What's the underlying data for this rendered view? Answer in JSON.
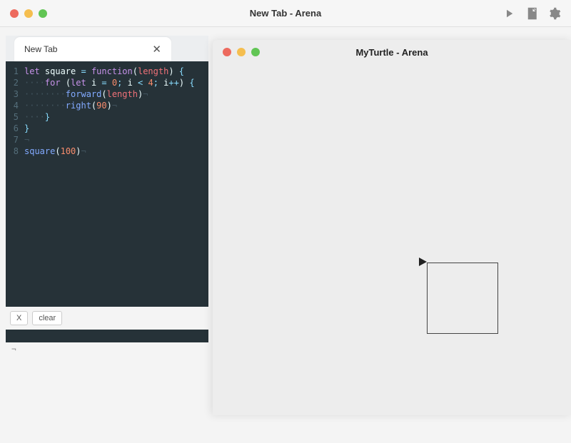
{
  "main_window": {
    "title": "New Tab - Arena",
    "toolbar": {
      "run_icon": "play-icon",
      "doc_icon": "document-icon",
      "settings_icon": "gear-icon"
    }
  },
  "editor": {
    "tab": {
      "label": "New Tab",
      "close_glyph": "✕"
    },
    "lines": [
      {
        "n": "1",
        "tokens": [
          {
            "t": "let ",
            "c": "tok-kw"
          },
          {
            "t": "square",
            "c": "tok-ident"
          },
          {
            "t": " = ",
            "c": "tok-op"
          },
          {
            "t": "function",
            "c": "tok-kw"
          },
          {
            "t": "(",
            "c": "tok-paren"
          },
          {
            "t": "length",
            "c": "tok-special"
          },
          {
            "t": ")",
            "c": "tok-paren"
          },
          {
            "t": " {",
            "c": "tok-brace"
          }
        ]
      },
      {
        "n": "2",
        "tokens": [
          {
            "t": "····",
            "c": "dots"
          },
          {
            "t": "for ",
            "c": "tok-kw"
          },
          {
            "t": "(",
            "c": "tok-paren"
          },
          {
            "t": "let ",
            "c": "tok-kw"
          },
          {
            "t": "i",
            "c": "tok-ident"
          },
          {
            "t": " = ",
            "c": "tok-op"
          },
          {
            "t": "0",
            "c": "tok-num"
          },
          {
            "t": "; ",
            "c": "tok-op"
          },
          {
            "t": "i",
            "c": "tok-ident"
          },
          {
            "t": " < ",
            "c": "tok-op"
          },
          {
            "t": "4",
            "c": "tok-num"
          },
          {
            "t": "; ",
            "c": "tok-op"
          },
          {
            "t": "i",
            "c": "tok-ident"
          },
          {
            "t": "++",
            "c": "tok-op"
          },
          {
            "t": ")",
            "c": "tok-paren"
          },
          {
            "t": " {",
            "c": "tok-brace"
          }
        ]
      },
      {
        "n": "3",
        "tokens": [
          {
            "t": "········",
            "c": "dots"
          },
          {
            "t": "forward",
            "c": "tok-func"
          },
          {
            "t": "(",
            "c": "tok-paren"
          },
          {
            "t": "length",
            "c": "tok-special"
          },
          {
            "t": ")",
            "c": "tok-paren"
          },
          {
            "t": "¬",
            "c": "dots"
          }
        ]
      },
      {
        "n": "4",
        "tokens": [
          {
            "t": "········",
            "c": "dots"
          },
          {
            "t": "right",
            "c": "tok-func"
          },
          {
            "t": "(",
            "c": "tok-paren"
          },
          {
            "t": "90",
            "c": "tok-num"
          },
          {
            "t": ")",
            "c": "tok-paren"
          },
          {
            "t": "¬",
            "c": "dots"
          }
        ]
      },
      {
        "n": "5",
        "tokens": [
          {
            "t": "····",
            "c": "dots"
          },
          {
            "t": "}",
            "c": "tok-brace"
          }
        ]
      },
      {
        "n": "6",
        "tokens": [
          {
            "t": "}",
            "c": "tok-brace"
          }
        ]
      },
      {
        "n": "7",
        "tokens": [
          {
            "t": "¬",
            "c": "dots"
          }
        ]
      },
      {
        "n": "8",
        "tokens": [
          {
            "t": "square",
            "c": "tok-func"
          },
          {
            "t": "(",
            "c": "tok-paren"
          },
          {
            "t": "100",
            "c": "tok-num"
          },
          {
            "t": ")",
            "c": "tok-paren"
          },
          {
            "t": "¬",
            "c": "dots"
          }
        ]
      }
    ]
  },
  "console": {
    "close_btn": "X",
    "clear_btn": "clear"
  },
  "cursor_hint": "¬",
  "turtle_window": {
    "title": "MyTurtle - Arena",
    "square_size": 100
  }
}
